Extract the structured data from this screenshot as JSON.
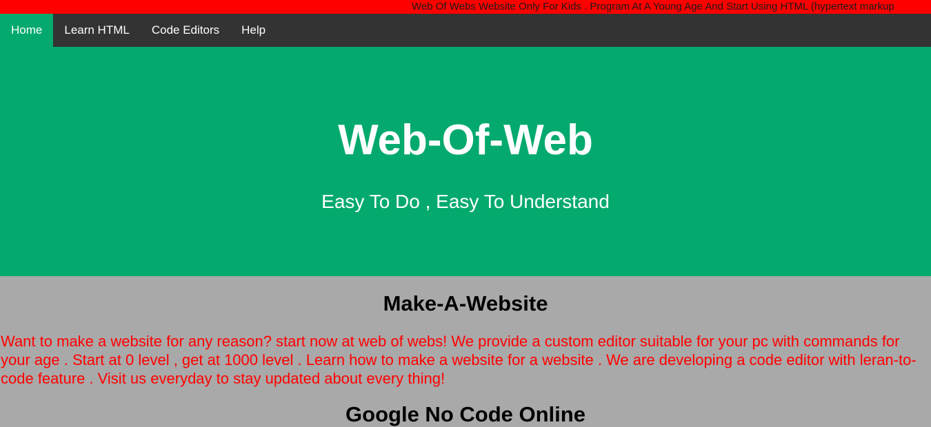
{
  "marquee": {
    "text": "Web Of Webs Website Only For Kids . Program At A Young Age And Start Using HTML (hypertext markup"
  },
  "nav": {
    "items": [
      {
        "label": "Home",
        "active": true
      },
      {
        "label": "Learn HTML",
        "active": false
      },
      {
        "label": "Code Editors",
        "active": false
      },
      {
        "label": "Help",
        "active": false
      }
    ]
  },
  "hero": {
    "title": "Web-Of-Web",
    "subtitle": "Easy To Do , Easy To Understand"
  },
  "sections": [
    {
      "heading": "Make-A-Website",
      "text": "Want to make a website for any reason? start now at web of webs! We provide a custom editor suitable for your pc with commands for your age . Start at 0 level , get at 1000 level . Learn how to make a website for a website . We are developing a code editor with leran-to-code feature . Visit us everyday to stay updated about every thing!"
    },
    {
      "heading": "Google No Code Online"
    }
  ],
  "colors": {
    "marquee_bg": "#ff0000",
    "nav_bg": "#333333",
    "accent": "#04aa6d",
    "content_bg": "#a9a9a9",
    "body_text": "#ff0000"
  }
}
